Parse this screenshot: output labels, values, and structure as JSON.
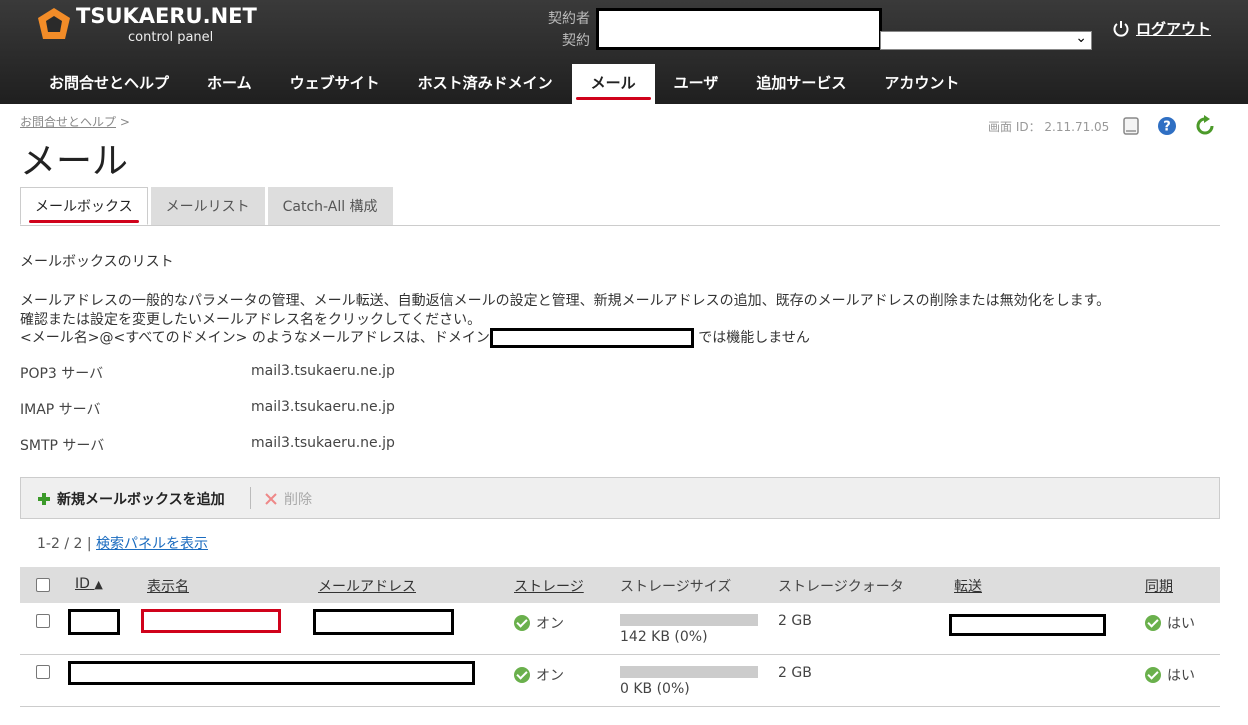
{
  "brand": {
    "title": "TSUKAERU.NET",
    "subtitle": "control panel",
    "accent": "#f28c28"
  },
  "header": {
    "contractor_label": "契約者",
    "contract_label": "契約",
    "logout_label": "ログアウト"
  },
  "nav": [
    {
      "label": "お問合せとヘルプ"
    },
    {
      "label": "ホーム"
    },
    {
      "label": "ウェブサイト"
    },
    {
      "label": "ホスト済みドメイン"
    },
    {
      "label": "メール",
      "active": true
    },
    {
      "label": "ユーザ"
    },
    {
      "label": "追加サービス"
    },
    {
      "label": "アカウント"
    }
  ],
  "breadcrumb": {
    "link": "お問合せとヘルプ",
    "separator": ">"
  },
  "screen_id": "画面 ID： 2.11.71.05",
  "page_title": "メール",
  "tabs": [
    {
      "label": "メールボックス",
      "active": true
    },
    {
      "label": "メールリスト"
    },
    {
      "label": "Catch-All 構成"
    }
  ],
  "intro": {
    "heading": "メールボックスのリスト",
    "line1": "メールアドレスの一般的なパラメータの管理、メール転送、自動返信メールの設定と管理、新規メールアドレスの追加、既存のメールアドレスの削除または無効化をします。",
    "line2": "確認または設定を変更したいメールアドレス名をクリックしてください。",
    "line3_prefix": "<メール名>@<すべてのドメイン> のようなメールアドレスは、ドメイン",
    "line3_suffix": " では機能しません"
  },
  "servers": [
    {
      "label": "POP3 サーバ",
      "value": "mail3.tsukaeru.ne.jp"
    },
    {
      "label": "IMAP サーバ",
      "value": "mail3.tsukaeru.ne.jp"
    },
    {
      "label": "SMTP サーバ",
      "value": "mail3.tsukaeru.ne.jp"
    }
  ],
  "toolbar": {
    "add_label": "新規メールボックスを追加",
    "delete_label": "削除"
  },
  "list": {
    "count": "1-2 / 2",
    "separator": "|",
    "search_link": "検索パネルを表示"
  },
  "table": {
    "headers": [
      "ID",
      "表示名",
      "メールアドレス",
      "ストレージ",
      "ストレージサイズ",
      "ストレージクォータ",
      "転送",
      "同期"
    ],
    "rows": [
      {
        "storage": "オン",
        "size": "142 KB (0%)",
        "quota": "2 GB",
        "sync": "はい",
        "usage": 0
      },
      {
        "storage": "オン",
        "size": "0 KB (0%)",
        "quota": "2 GB",
        "sync": "はい",
        "usage": 0
      }
    ]
  }
}
